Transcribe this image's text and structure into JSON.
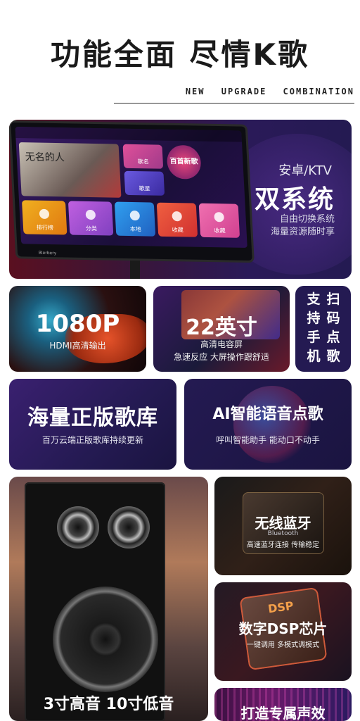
{
  "header": {
    "headline": "功能全面 尽情K歌",
    "subline": "NEW UPGRADE COMBINATION"
  },
  "hero": {
    "tag": "安卓/KTV",
    "title": "双系统",
    "desc_1": "自由切换系统",
    "desc_2": "海量资源随时享",
    "screen": {
      "poster_text": "无名的人",
      "badge_text": "百首新歌",
      "brand": "Blerbery",
      "tiles": [
        "歌名",
        "歌星",
        "排行榜",
        "分类",
        "本地",
        "收藏",
        "收藏"
      ]
    }
  },
  "feature_1080": {
    "title": "1080P",
    "desc": "HDMI高清输出"
  },
  "feature_22": {
    "title": "22英寸",
    "desc_1": "高清电容屏",
    "desc_2": "急速反应 大屏操作跟舒适"
  },
  "feature_scan": {
    "chars": [
      "支",
      "扫",
      "持",
      "码",
      "手",
      "点",
      "机",
      "歌"
    ]
  },
  "feature_library": {
    "title": "海量正版歌库",
    "desc": "百万云端正版歌库持续更新"
  },
  "feature_ai": {
    "title": "AI智能语音点歌",
    "desc": "呼叫智能助手 能动口不动手"
  },
  "feature_speaker": {
    "title": "3寸高音 10寸低音"
  },
  "feature_bt": {
    "title": "无线蓝牙",
    "bt_mark": "Bluetooth",
    "desc": "高速蓝牙连接 传输稳定"
  },
  "feature_dsp": {
    "mark": "DSP",
    "title": "数字DSP芯片",
    "desc": "一键调用 多模式调模式"
  },
  "feature_sound": {
    "title": "打造专属声效"
  }
}
